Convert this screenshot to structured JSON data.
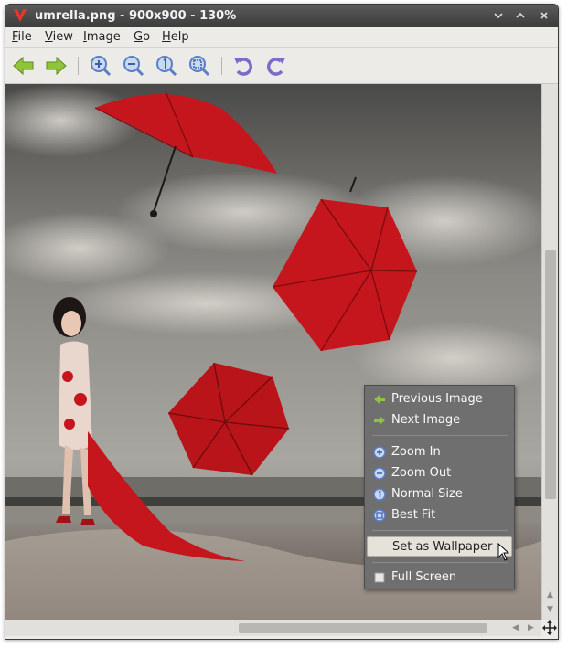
{
  "window": {
    "title": "umrella.png - 900x900 - 130%",
    "controls": [
      "minimize",
      "maximize",
      "close"
    ]
  },
  "menubar": {
    "items": [
      {
        "label": "File",
        "mnemonic": "F"
      },
      {
        "label": "View",
        "mnemonic": "V"
      },
      {
        "label": "Image",
        "mnemonic": "I"
      },
      {
        "label": "Go",
        "mnemonic": "G"
      },
      {
        "label": "Help",
        "mnemonic": "H"
      }
    ]
  },
  "toolbar": {
    "buttons": [
      "back-arrow-icon",
      "forward-arrow-icon",
      "zoom-in-icon",
      "zoom-out-icon",
      "normal-size-icon",
      "best-fit-icon",
      "rotate-left-icon",
      "rotate-right-icon"
    ]
  },
  "context_menu": {
    "items": [
      {
        "label": "Previous Image",
        "icon": "back-arrow-icon"
      },
      {
        "label": "Next Image",
        "icon": "forward-arrow-icon"
      },
      {
        "label": "Zoom In",
        "icon": "zoom-in-icon"
      },
      {
        "label": "Zoom Out",
        "icon": "zoom-out-icon"
      },
      {
        "label": "Normal Size",
        "icon": "normal-size-icon"
      },
      {
        "label": "Best Fit",
        "icon": "best-fit-icon"
      },
      {
        "label": "Set as Wallpaper",
        "icon": ""
      },
      {
        "label": "Full Screen",
        "icon": "checkbox-icon"
      }
    ],
    "hovered": "Set as Wallpaper"
  },
  "colors": {
    "accent_green": "#8fc43c",
    "accent_blue": "#5a7fc7",
    "umbrella_red": "#c4161c",
    "menu_bg": "#6f6f6f"
  }
}
